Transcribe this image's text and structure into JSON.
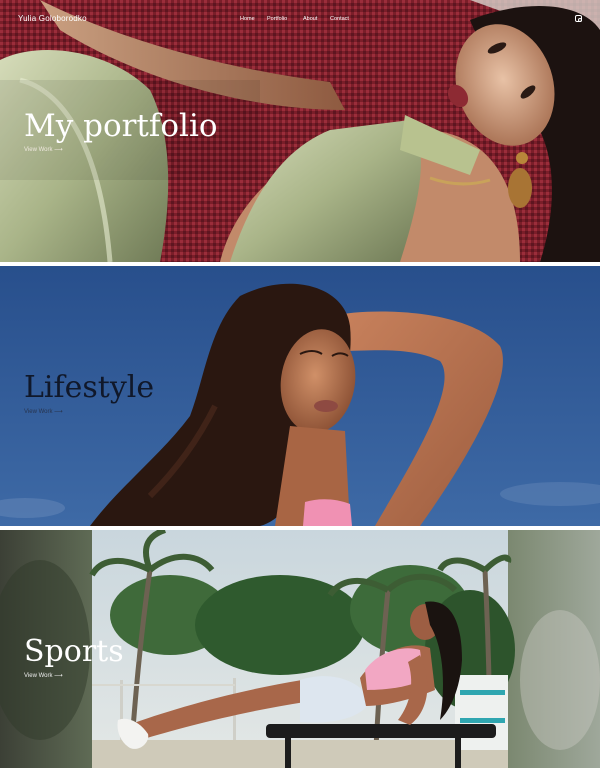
{
  "header": {
    "brand": "Yulia Goloborodko",
    "nav": {
      "home": "Home",
      "portfolio": "Portfolio",
      "about": "About",
      "contact": "Contact"
    },
    "instagram_icon": "instagram-icon"
  },
  "sections": [
    {
      "title": "My portfolio",
      "link": "View Work ⟶"
    },
    {
      "title": "Lifestyle",
      "link": "View Work ⟶"
    },
    {
      "title": "Sports",
      "link": "View Work ⟶"
    }
  ],
  "colors": {
    "knit_red": "#7b1f2a",
    "satin_green": "#b9c49a",
    "sky_blue": "#2f5c9a",
    "skin": "#b77958",
    "white": "#ffffff"
  }
}
